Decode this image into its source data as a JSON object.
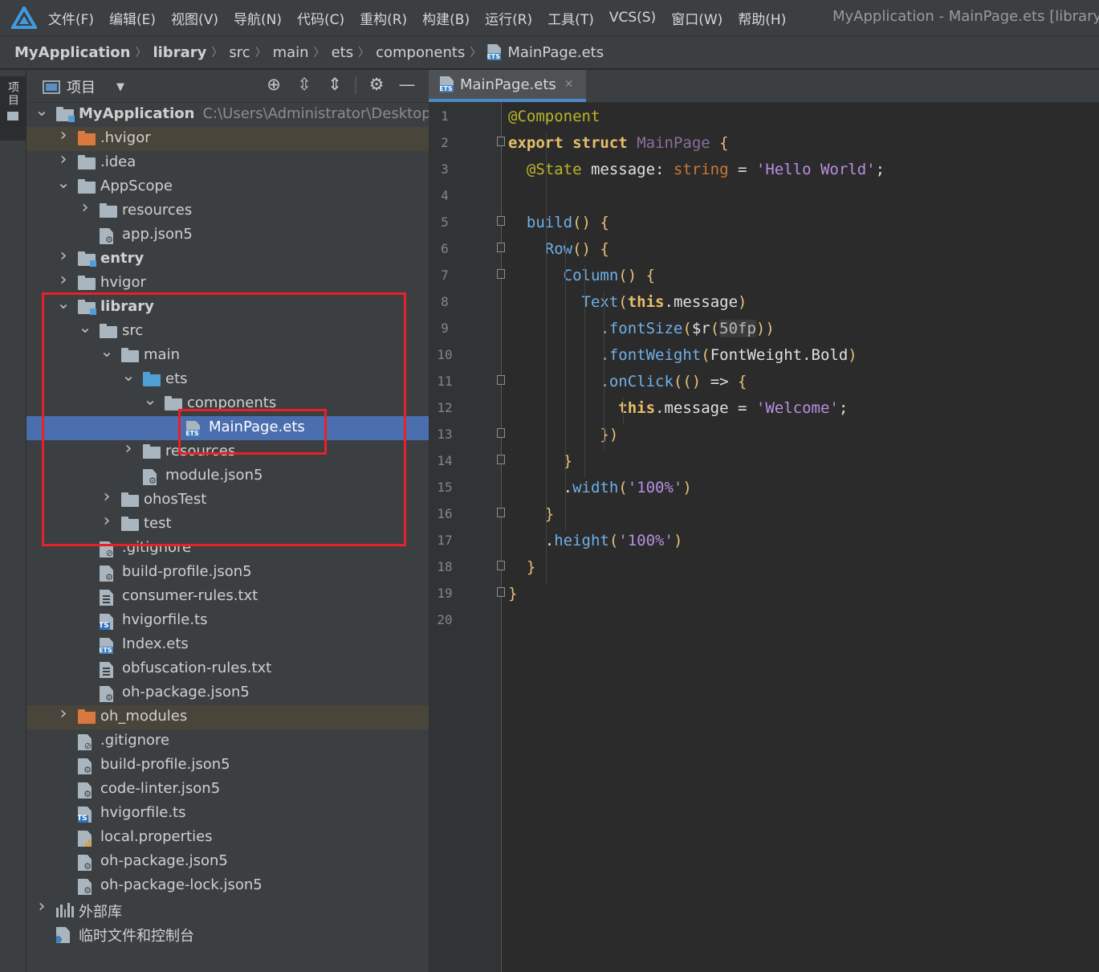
{
  "menubar": {
    "items": [
      "文件(F)",
      "编辑(E)",
      "视图(V)",
      "导航(N)",
      "代码(C)",
      "重构(R)",
      "构建(B)",
      "运行(R)",
      "工具(T)",
      "VCS(S)",
      "窗口(W)",
      "帮助(H)"
    ],
    "window_title": "MyApplication - MainPage.ets [library]"
  },
  "breadcrumb": {
    "items": [
      "MyApplication",
      "library",
      "src",
      "main",
      "ets",
      "components",
      "MainPage.ets"
    ]
  },
  "left_strip": {
    "tab_label": "项目"
  },
  "project_panel": {
    "title": "项目",
    "tools": [
      "crosshair-icon",
      "expand-all-icon",
      "collapse-all-icon",
      "gear-icon",
      "minimize-icon"
    ],
    "tree": [
      {
        "label": "MyApplication",
        "path": "C:\\Users\\Administrator\\Desktop\\H",
        "depth": 0,
        "arrow": "down",
        "icon": "module-folder",
        "bold": true
      },
      {
        "label": ".hvigor",
        "depth": 1,
        "arrow": "right",
        "icon": "folder-orange",
        "highlight": "orange"
      },
      {
        "label": ".idea",
        "depth": 1,
        "arrow": "right",
        "icon": "folder"
      },
      {
        "label": "AppScope",
        "depth": 1,
        "arrow": "down",
        "icon": "folder"
      },
      {
        "label": "resources",
        "depth": 2,
        "arrow": "right",
        "icon": "folder"
      },
      {
        "label": "app.json5",
        "depth": 2,
        "arrow": "",
        "icon": "json"
      },
      {
        "label": "entry",
        "depth": 1,
        "arrow": "right",
        "icon": "module-folder",
        "bold": true
      },
      {
        "label": "hvigor",
        "depth": 1,
        "arrow": "right",
        "icon": "folder"
      },
      {
        "label": "library",
        "depth": 1,
        "arrow": "down",
        "icon": "module-folder",
        "bold": true
      },
      {
        "label": "src",
        "depth": 2,
        "arrow": "down",
        "icon": "folder"
      },
      {
        "label": "main",
        "depth": 3,
        "arrow": "down",
        "icon": "folder"
      },
      {
        "label": "ets",
        "depth": 4,
        "arrow": "down",
        "icon": "folder-blue"
      },
      {
        "label": "components",
        "depth": 5,
        "arrow": "down",
        "icon": "folder"
      },
      {
        "label": "MainPage.ets",
        "depth": 6,
        "arrow": "",
        "icon": "ets",
        "selected": true
      },
      {
        "label": "resources",
        "depth": 4,
        "arrow": "right",
        "icon": "folder"
      },
      {
        "label": "module.json5",
        "depth": 4,
        "arrow": "",
        "icon": "json"
      },
      {
        "label": "ohosTest",
        "depth": 3,
        "arrow": "right",
        "icon": "folder"
      },
      {
        "label": "test",
        "depth": 3,
        "arrow": "right",
        "icon": "folder"
      },
      {
        "label": ".gitignore",
        "depth": 2,
        "arrow": "",
        "icon": "gitignore"
      },
      {
        "label": "build-profile.json5",
        "depth": 2,
        "arrow": "",
        "icon": "json"
      },
      {
        "label": "consumer-rules.txt",
        "depth": 2,
        "arrow": "",
        "icon": "txt"
      },
      {
        "label": "hvigorfile.ts",
        "depth": 2,
        "arrow": "",
        "icon": "ts"
      },
      {
        "label": "Index.ets",
        "depth": 2,
        "arrow": "",
        "icon": "ets"
      },
      {
        "label": "obfuscation-rules.txt",
        "depth": 2,
        "arrow": "",
        "icon": "txt"
      },
      {
        "label": "oh-package.json5",
        "depth": 2,
        "arrow": "",
        "icon": "json"
      },
      {
        "label": "oh_modules",
        "depth": 1,
        "arrow": "right",
        "icon": "folder-orange",
        "highlight": "orange"
      },
      {
        "label": ".gitignore",
        "depth": 1,
        "arrow": "",
        "icon": "gitignore"
      },
      {
        "label": "build-profile.json5",
        "depth": 1,
        "arrow": "",
        "icon": "json"
      },
      {
        "label": "code-linter.json5",
        "depth": 1,
        "arrow": "",
        "icon": "json"
      },
      {
        "label": "hvigorfile.ts",
        "depth": 1,
        "arrow": "",
        "icon": "ts"
      },
      {
        "label": "local.properties",
        "depth": 1,
        "arrow": "",
        "icon": "properties"
      },
      {
        "label": "oh-package.json5",
        "depth": 1,
        "arrow": "",
        "icon": "json"
      },
      {
        "label": "oh-package-lock.json5",
        "depth": 1,
        "arrow": "",
        "icon": "json"
      },
      {
        "label": "外部库",
        "depth": 0,
        "arrow": "right",
        "icon": "library"
      },
      {
        "label": "临时文件和控制台",
        "depth": 0,
        "arrow": "",
        "icon": "scratch"
      }
    ]
  },
  "editor": {
    "tab_label": "MainPage.ets",
    "lines": [
      {
        "n": "1",
        "fold": "",
        "tokens": [
          [
            "ann",
            "@Component"
          ]
        ]
      },
      {
        "n": "2",
        "fold": "open",
        "tokens": [
          [
            "kw",
            "export"
          ],
          [
            "plain",
            " "
          ],
          [
            "kw",
            "struct"
          ],
          [
            "plain",
            " "
          ],
          [
            "type",
            "MainPage"
          ],
          [
            "plain",
            " "
          ],
          [
            "paren",
            "{"
          ]
        ]
      },
      {
        "n": "3",
        "fold": "",
        "tokens": [
          [
            "plain",
            "  "
          ],
          [
            "ann",
            "@State"
          ],
          [
            "plain",
            " message: "
          ],
          [
            "kw2",
            "string"
          ],
          [
            "plain",
            " = "
          ],
          [
            "str",
            "'Hello World'"
          ],
          [
            "plain",
            ";"
          ]
        ]
      },
      {
        "n": "4",
        "fold": "",
        "tokens": []
      },
      {
        "n": "5",
        "fold": "open",
        "tokens": [
          [
            "plain",
            "  "
          ],
          [
            "fn",
            "build"
          ],
          [
            "paren",
            "()"
          ],
          [
            "plain",
            " "
          ],
          [
            "paren",
            "{"
          ]
        ]
      },
      {
        "n": "6",
        "fold": "open",
        "tokens": [
          [
            "plain",
            "    "
          ],
          [
            "fn",
            "Row"
          ],
          [
            "paren",
            "()"
          ],
          [
            "plain",
            " "
          ],
          [
            "paren",
            "{"
          ]
        ]
      },
      {
        "n": "7",
        "fold": "open",
        "tokens": [
          [
            "plain",
            "      "
          ],
          [
            "fn",
            "Column"
          ],
          [
            "paren",
            "()"
          ],
          [
            "plain",
            " "
          ],
          [
            "paren",
            "{"
          ]
        ]
      },
      {
        "n": "8",
        "fold": "",
        "tokens": [
          [
            "plain",
            "        "
          ],
          [
            "fn",
            "Text"
          ],
          [
            "paren",
            "("
          ],
          [
            "this",
            "this"
          ],
          [
            "plain",
            ".message"
          ],
          [
            "paren",
            ")"
          ]
        ]
      },
      {
        "n": "9",
        "fold": "",
        "tokens": [
          [
            "plain",
            "          ."
          ],
          [
            "fn",
            "fontSize"
          ],
          [
            "paren",
            "("
          ],
          [
            "plain",
            "$r"
          ],
          [
            "paren",
            "("
          ],
          [
            "dim",
            "50fp"
          ],
          [
            "paren",
            "))"
          ]
        ]
      },
      {
        "n": "10",
        "fold": "",
        "tokens": [
          [
            "plain",
            "          ."
          ],
          [
            "fn",
            "fontWeight"
          ],
          [
            "paren",
            "("
          ],
          [
            "plain",
            "FontWeight.Bold"
          ],
          [
            "paren",
            ")"
          ]
        ]
      },
      {
        "n": "11",
        "fold": "open",
        "tokens": [
          [
            "plain",
            "          ."
          ],
          [
            "fn",
            "onClick"
          ],
          [
            "paren",
            "(()"
          ],
          [
            "plain",
            " => "
          ],
          [
            "paren",
            "{"
          ]
        ]
      },
      {
        "n": "12",
        "fold": "",
        "tokens": [
          [
            "plain",
            "            "
          ],
          [
            "this",
            "this"
          ],
          [
            "plain",
            ".message = "
          ],
          [
            "str",
            "'Welcome'"
          ],
          [
            "plain",
            ";"
          ]
        ]
      },
      {
        "n": "13",
        "fold": "close",
        "tokens": [
          [
            "plain",
            "          "
          ],
          [
            "paren",
            "})"
          ]
        ]
      },
      {
        "n": "14",
        "fold": "close",
        "tokens": [
          [
            "plain",
            "      "
          ],
          [
            "paren",
            "}"
          ]
        ]
      },
      {
        "n": "15",
        "fold": "",
        "tokens": [
          [
            "plain",
            "      ."
          ],
          [
            "fn",
            "width"
          ],
          [
            "paren",
            "("
          ],
          [
            "str",
            "'100%'"
          ],
          [
            "paren",
            ")"
          ]
        ]
      },
      {
        "n": "16",
        "fold": "close",
        "tokens": [
          [
            "plain",
            "    "
          ],
          [
            "paren",
            "}"
          ]
        ]
      },
      {
        "n": "17",
        "fold": "",
        "tokens": [
          [
            "plain",
            "    ."
          ],
          [
            "fn",
            "height"
          ],
          [
            "paren",
            "("
          ],
          [
            "str",
            "'100%'"
          ],
          [
            "paren",
            ")"
          ]
        ]
      },
      {
        "n": "18",
        "fold": "close",
        "tokens": [
          [
            "plain",
            "  "
          ],
          [
            "paren",
            "}"
          ]
        ]
      },
      {
        "n": "19",
        "fold": "close",
        "tokens": [
          [
            "paren",
            "}"
          ]
        ]
      },
      {
        "n": "20",
        "fold": "",
        "tokens": []
      }
    ]
  }
}
